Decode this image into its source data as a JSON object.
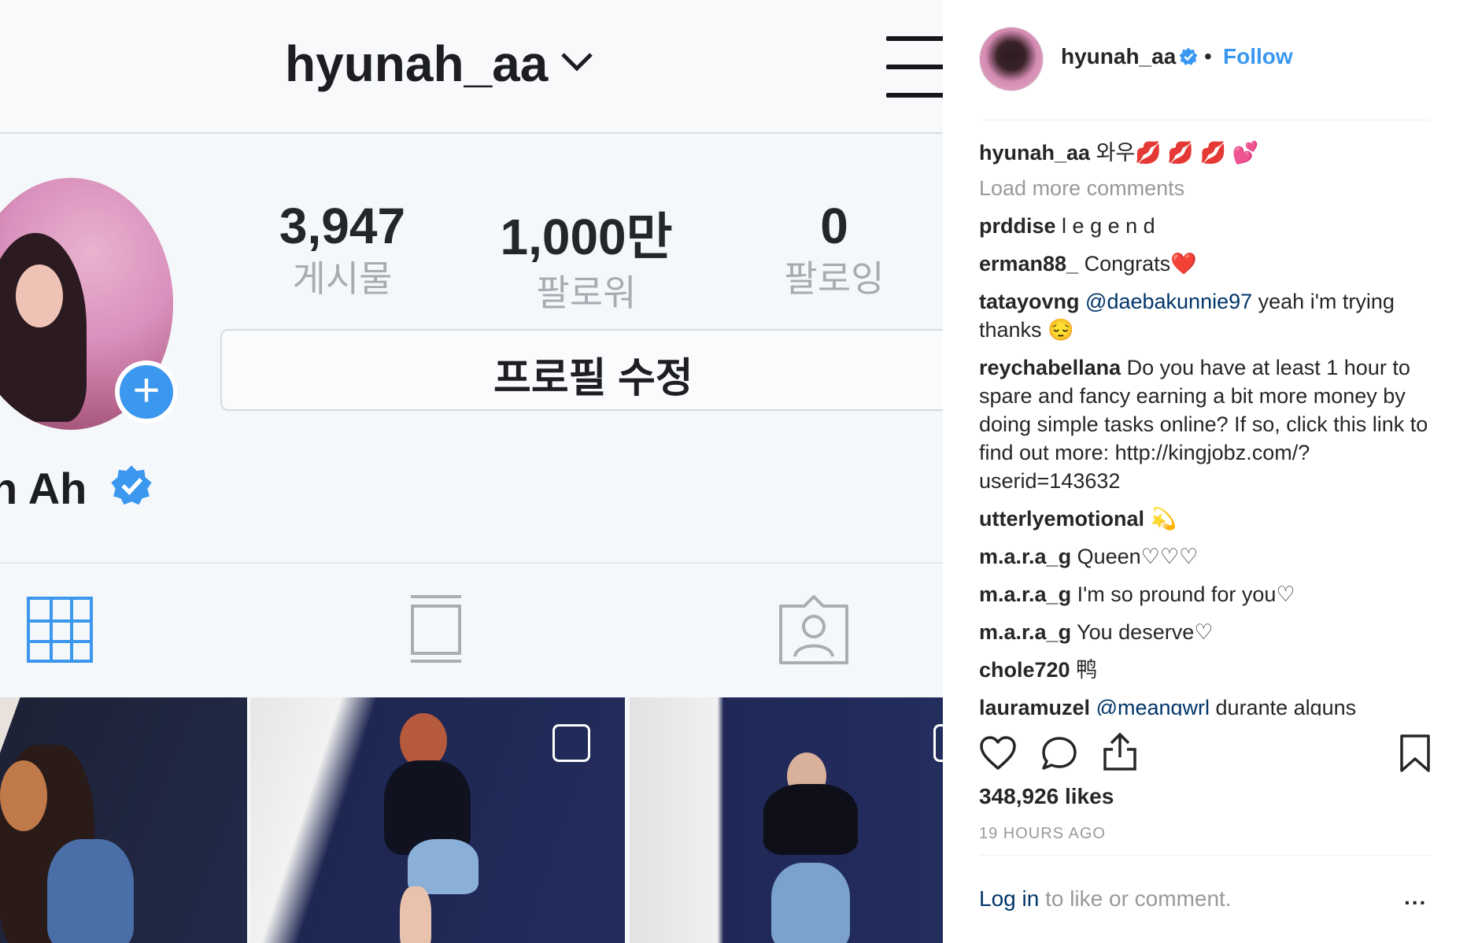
{
  "phone": {
    "username": "hyunah_aa",
    "stats": [
      {
        "num": "3,947",
        "label": "게시물"
      },
      {
        "num": "1,000만",
        "label": "팔로워"
      },
      {
        "num": "0",
        "label": "팔로잉"
      }
    ],
    "edit_profile": "프로필 수정",
    "display_name": "n Ah"
  },
  "post": {
    "username": "hyunah_aa",
    "follow": "Follow",
    "dot": "•",
    "caption": {
      "user": "hyunah_aa",
      "text": "와우💋 💋 💋 💕"
    },
    "load_more": "Load more comments",
    "comments": [
      {
        "user": "prddise",
        "text": "l e g e n d"
      },
      {
        "user": "erman88_",
        "text": "Congrats❤️"
      },
      {
        "user": "tatayovng",
        "mention": "@daebakunnie97",
        "text": " yeah i'm trying thanks 😔"
      },
      {
        "user": "reychabellana",
        "text": "Do you have at least 1 hour to spare and fancy earning a bit more money by doing simple tasks online? If so, click this link to find out more: http://kingjobz.com/?userid=143632"
      },
      {
        "user": "utterlyemotional",
        "text": "💫"
      },
      {
        "user": "m.a.r.a_g",
        "text": "Queen♡♡♡"
      },
      {
        "user": "m.a.r.a_g",
        "text": "I'm so pround for you♡"
      },
      {
        "user": "m.a.r.a_g",
        "text": "You deserve♡"
      },
      {
        "user": "chole720",
        "text": "鸭"
      },
      {
        "user": "lauramuzel",
        "mention": "@meangwrl",
        "text": " durante alguns"
      }
    ],
    "likes": "348,926 likes",
    "time": "19 HOURS AGO",
    "login_link": "Log in",
    "login_text": " to like or comment.",
    "more": "..."
  },
  "colors": {
    "accent": "#3897f0",
    "verified": "#3b98ee",
    "text": "#262626",
    "muted": "#999999"
  }
}
